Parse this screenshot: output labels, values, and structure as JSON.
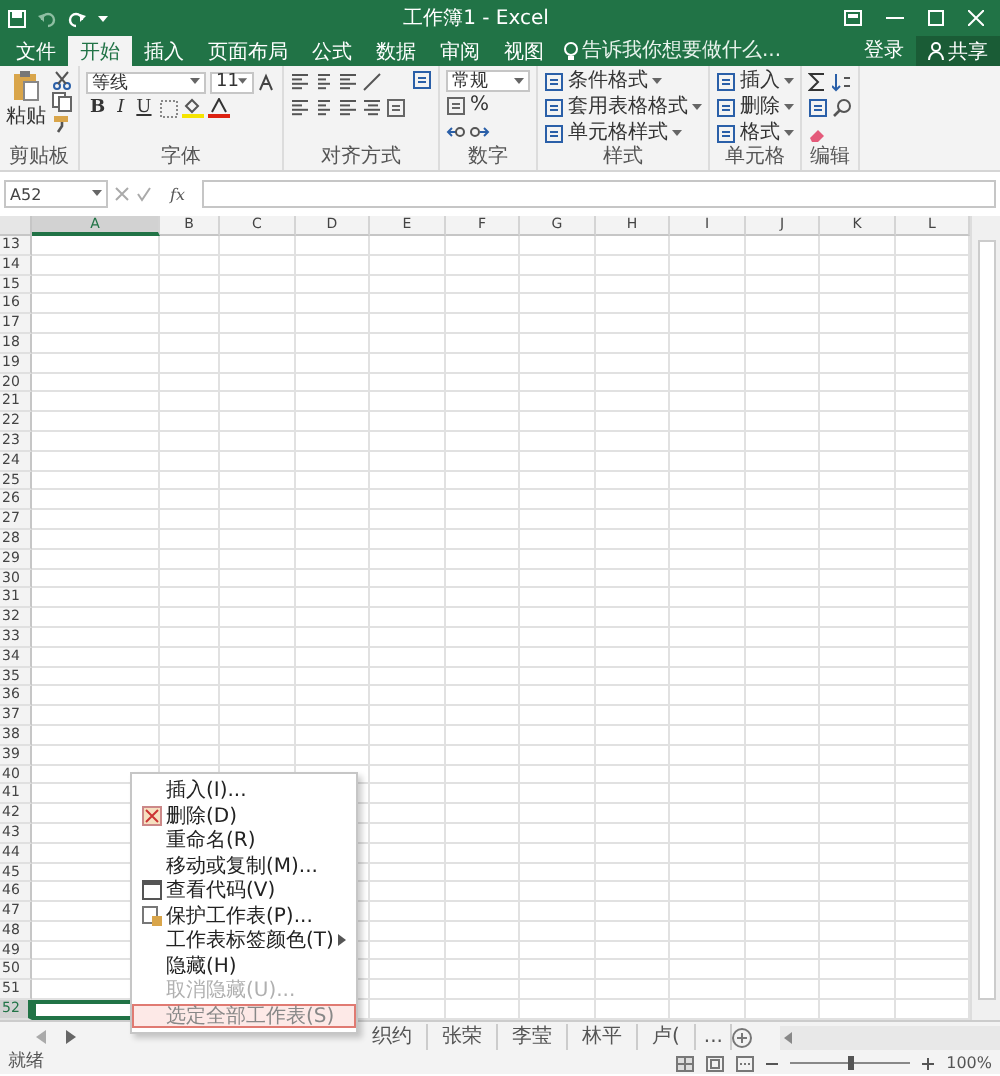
{
  "window": {
    "title": "工作簿1 - Excel"
  },
  "ribbon_tabs": [
    {
      "label": "文件",
      "selected": false
    },
    {
      "label": "开始",
      "selected": true
    },
    {
      "label": "插入",
      "selected": false
    },
    {
      "label": "页面布局",
      "selected": false
    },
    {
      "label": "公式",
      "selected": false
    },
    {
      "label": "数据",
      "selected": false
    },
    {
      "label": "审阅",
      "selected": false
    },
    {
      "label": "视图",
      "selected": false
    }
  ],
  "tell_me": {
    "placeholder": "告诉我你想要做什么..."
  },
  "account": {
    "sign_in": "登录",
    "share": "共享"
  },
  "ribbon_groups": [
    {
      "kind": "clipboard",
      "label": "剪贴板",
      "paste": "粘贴"
    },
    {
      "kind": "font",
      "label": "字体",
      "font": "等线",
      "size": "11",
      "format_buttons": [
        "B",
        "I",
        "U"
      ]
    },
    {
      "kind": "alignment",
      "label": "对齐方式"
    },
    {
      "kind": "number",
      "label": "数字",
      "format": "常规",
      "percent": "%"
    },
    {
      "kind": "styles",
      "label": "样式",
      "buttons": [
        "条件格式",
        "套用表格格式",
        "单元格样式"
      ]
    },
    {
      "kind": "cells",
      "label": "单元格",
      "buttons": [
        "插入",
        "删除",
        "格式"
      ]
    },
    {
      "kind": "editing",
      "label": "编辑"
    }
  ],
  "formula_bar": {
    "name_box": "A52",
    "function_label": "fx"
  },
  "columns": [
    {
      "label": "A",
      "selected": true
    },
    {
      "label": "B",
      "selected": false
    },
    {
      "label": "C",
      "selected": false
    },
    {
      "label": "D",
      "selected": false
    },
    {
      "label": "E",
      "selected": false
    },
    {
      "label": "F",
      "selected": false
    },
    {
      "label": "G",
      "selected": false
    },
    {
      "label": "H",
      "selected": false
    },
    {
      "label": "I",
      "selected": false
    },
    {
      "label": "J",
      "selected": false
    },
    {
      "label": "K",
      "selected": false
    },
    {
      "label": "L",
      "selected": false
    }
  ],
  "rows": [
    {
      "label": "13",
      "selected": false
    },
    {
      "label": "14",
      "selected": false
    },
    {
      "label": "15",
      "selected": false
    },
    {
      "label": "16",
      "selected": false
    },
    {
      "label": "17",
      "selected": false
    },
    {
      "label": "18",
      "selected": false
    },
    {
      "label": "19",
      "selected": false
    },
    {
      "label": "20",
      "selected": false
    },
    {
      "label": "21",
      "selected": false
    },
    {
      "label": "22",
      "selected": false
    },
    {
      "label": "23",
      "selected": false
    },
    {
      "label": "24",
      "selected": false
    },
    {
      "label": "25",
      "selected": false
    },
    {
      "label": "26",
      "selected": false
    },
    {
      "label": "27",
      "selected": false
    },
    {
      "label": "28",
      "selected": false
    },
    {
      "label": "29",
      "selected": false
    },
    {
      "label": "30",
      "selected": false
    },
    {
      "label": "31",
      "selected": false
    },
    {
      "label": "32",
      "selected": false
    },
    {
      "label": "33",
      "selected": false
    },
    {
      "label": "34",
      "selected": false
    },
    {
      "label": "35",
      "selected": false
    },
    {
      "label": "36",
      "selected": false
    },
    {
      "label": "37",
      "selected": false
    },
    {
      "label": "38",
      "selected": false
    },
    {
      "label": "39",
      "selected": false
    },
    {
      "label": "40",
      "selected": false
    },
    {
      "label": "41",
      "selected": false
    },
    {
      "label": "42",
      "selected": false
    },
    {
      "label": "43",
      "selected": false
    },
    {
      "label": "44",
      "selected": false
    },
    {
      "label": "45",
      "selected": false
    },
    {
      "label": "46",
      "selected": false
    },
    {
      "label": "47",
      "selected": false
    },
    {
      "label": "48",
      "selected": false
    },
    {
      "label": "49",
      "selected": false
    },
    {
      "label": "50",
      "selected": false
    },
    {
      "label": "51",
      "selected": false
    },
    {
      "label": "52",
      "selected": true
    }
  ],
  "context_menu": [
    {
      "kind": "plain",
      "label": "插入(I)...",
      "disabled": false,
      "selected": false
    },
    {
      "kind": "delete",
      "label": "删除(D)",
      "disabled": false,
      "selected": false
    },
    {
      "kind": "plain",
      "label": "重命名(R)",
      "disabled": false,
      "selected": false
    },
    {
      "kind": "plain",
      "label": "移动或复制(M)...",
      "disabled": false,
      "selected": false
    },
    {
      "kind": "view_code",
      "label": "查看代码(V)",
      "disabled": false,
      "selected": false
    },
    {
      "kind": "protect",
      "label": "保护工作表(P)...",
      "disabled": false,
      "selected": false
    },
    {
      "kind": "submenu",
      "label": "工作表标签颜色(T)",
      "disabled": false,
      "selected": false
    },
    {
      "kind": "plain",
      "label": "隐藏(H)",
      "disabled": false,
      "selected": false
    },
    {
      "kind": "plain",
      "label": "取消隐藏(U)...",
      "disabled": true,
      "selected": false
    },
    {
      "kind": "plain",
      "label": "选定全部工作表(S)",
      "disabled": false,
      "selected": true
    }
  ],
  "sheet_tabs": [
    {
      "label": "织约",
      "selected": false
    },
    {
      "label": "张荣",
      "selected": false
    },
    {
      "label": "李莹",
      "selected": false
    },
    {
      "label": "林平",
      "selected": false
    },
    {
      "label": "卢(",
      "selected": false
    }
  ],
  "more_sheets": "...",
  "status_bar": {
    "status": "就绪",
    "zoom": {
      "level": 0.5,
      "reading": "100%"
    }
  }
}
